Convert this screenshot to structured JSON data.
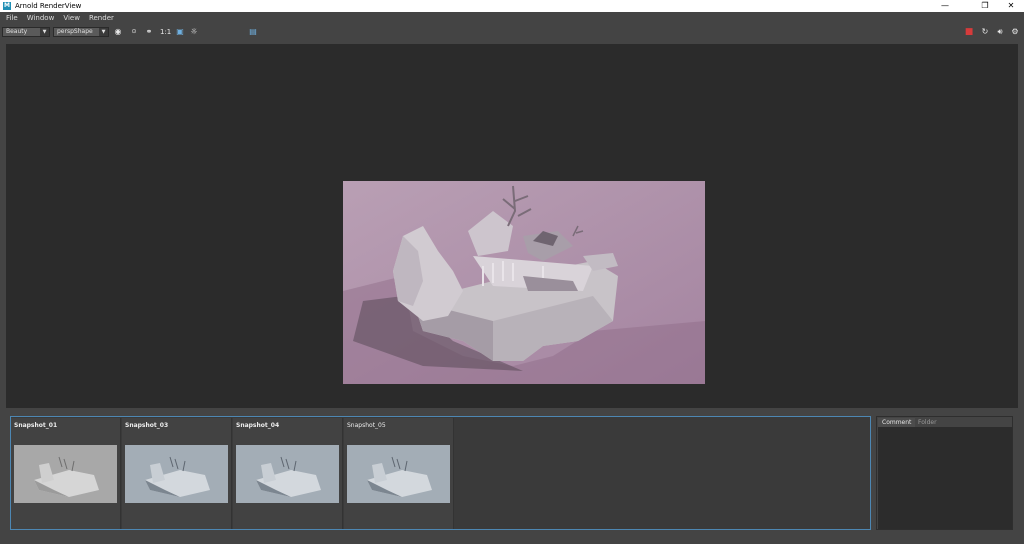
{
  "window": {
    "title": "Arnold RenderView",
    "app_icon": "M",
    "minimize": "—",
    "restore": "❐",
    "close": "✕"
  },
  "menu": [
    "File",
    "Window",
    "View",
    "Render"
  ],
  "toolbar": {
    "aov_select": "Beauty",
    "camera_select": "perspShape",
    "ratio_label": "1:1",
    "exposure_value": "0"
  },
  "snapshots": [
    {
      "label": "Snapshot_01",
      "bold": true
    },
    {
      "label": "Snapshot_03",
      "bold": true
    },
    {
      "label": "Snapshot_04",
      "bold": true
    },
    {
      "label": "Snapshot_05",
      "bold": false
    }
  ],
  "side_panel": {
    "tabs": [
      "Comment",
      "Folder"
    ]
  },
  "colors": {
    "accent": "#4d87b3",
    "stop": "#d63b3b",
    "render_bg": "#b79aaf"
  }
}
